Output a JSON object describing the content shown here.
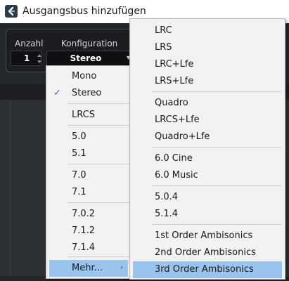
{
  "window": {
    "title": "Ausgangsbus hinzufügen"
  },
  "panel": {
    "count_header": "Anzahl",
    "config_header": "Konfiguration",
    "count_value": "1",
    "config_value": "Stereo"
  },
  "menu1": {
    "items": [
      "Mono",
      "Stereo",
      "LRCS",
      "5.0",
      "5.1",
      "7.0",
      "7.1",
      "7.0.2",
      "7.1.2",
      "7.1.4",
      "Mehr..."
    ],
    "checked": "Stereo",
    "highlighted": "Mehr..."
  },
  "menu2": {
    "items": [
      "LRC",
      "LRS",
      "LRC+Lfe",
      "LRS+Lfe",
      "Quadro",
      "LRCS+Lfe",
      "Quadro+Lfe",
      "6.0 Cine",
      "6.0 Music",
      "5.0.4",
      "5.1.4",
      "1st Order Ambisonics",
      "2nd Order Ambisonics",
      "3rd Order Ambisonics"
    ],
    "highlighted": "3rd Order Ambisonics"
  },
  "colors": {
    "highlight": "#9ac4ee",
    "menu_bg": "#f2f2f2",
    "dialog_bg": "#23262a"
  },
  "icons": {
    "app": "cubase-logo-icon",
    "check": "checkmark-icon",
    "submenu": "chevron-right-icon"
  }
}
